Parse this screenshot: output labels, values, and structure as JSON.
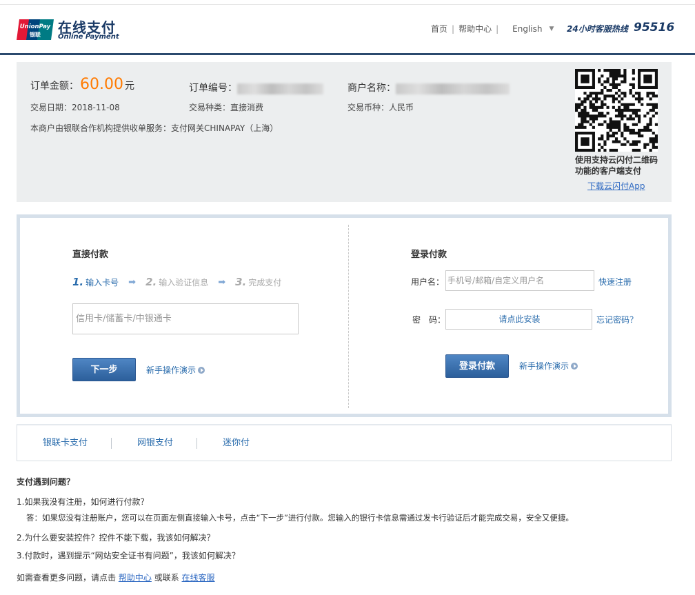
{
  "header": {
    "logo_brand": "UnionPay",
    "logo_brand_cn": "银联",
    "title_cn": "在线支付",
    "title_en": "Online Payment",
    "nav": [
      "首页",
      "帮助中心"
    ],
    "nav_sep": "|",
    "language": "English",
    "hotline_label": "24小时客服热线",
    "hotline_number": "95516",
    "brand_color": "#1a3a66"
  },
  "order": {
    "amount_label": "订单金额：",
    "amount": "60.00",
    "amount_unit": "元",
    "order_no_label": "订单编号：",
    "merchant_label": "商户名称：",
    "date_label": "交易日期：",
    "date": "2018-11-08",
    "type_label": "交易种类：",
    "type": "直接消费",
    "currency_label": "交易币种：",
    "currency": "人民币",
    "service_note": "本商户由银联合作机构提供收单服务：支付网关CHINAPAY（上海）",
    "qr_caption_1": "使用支持云闪付二维码",
    "qr_caption_2": "功能的客户端支付",
    "qr_link": "下载云闪付App",
    "amount_color": "#ff7a00"
  },
  "direct_pay": {
    "title": "直接付款",
    "steps": [
      {
        "num": "1.",
        "label": "输入卡号"
      },
      {
        "num": "2.",
        "label": "输入验证信息"
      },
      {
        "num": "3.",
        "label": "完成支付"
      }
    ],
    "card_placeholder": "信用卡/储蓄卡/中银通卡",
    "next_button": "下一步",
    "demo_link": "新手操作演示"
  },
  "login_pay": {
    "title": "登录付款",
    "username_label": "用户名：",
    "username_placeholder": "手机号/邮箱/自定义用户名",
    "register_link": "快速注册",
    "password_label": "密　码：",
    "password_install": "请点此安装",
    "forgot_link": "忘记密码？",
    "login_button": "登录付款",
    "demo_link": "新手操作演示"
  },
  "tabs": [
    "银联卡支付",
    "网银支付",
    "迷你付"
  ],
  "faq": {
    "title": "支付遇到问题？",
    "q1": "1.如果我没有注册，如何进行付款？",
    "a1": "答：如果您没有注册账户，您可以在页面左侧直接输入卡号，点击“下一步”进行付款。您输入的银行卡信息需通过发卡行验证后才能完成交易，安全又便捷。",
    "q2": "2.为什么要安装控件？控件不能下载，我该如何解决？",
    "q3": "3.付款时，遇到提示“网站安全证书有问题”，我该如何解决？",
    "more_prefix": "如需查看更多问题，请点击",
    "help_link": "帮助中心",
    "or_contact": "或联系",
    "service_link": "在线客服"
  }
}
